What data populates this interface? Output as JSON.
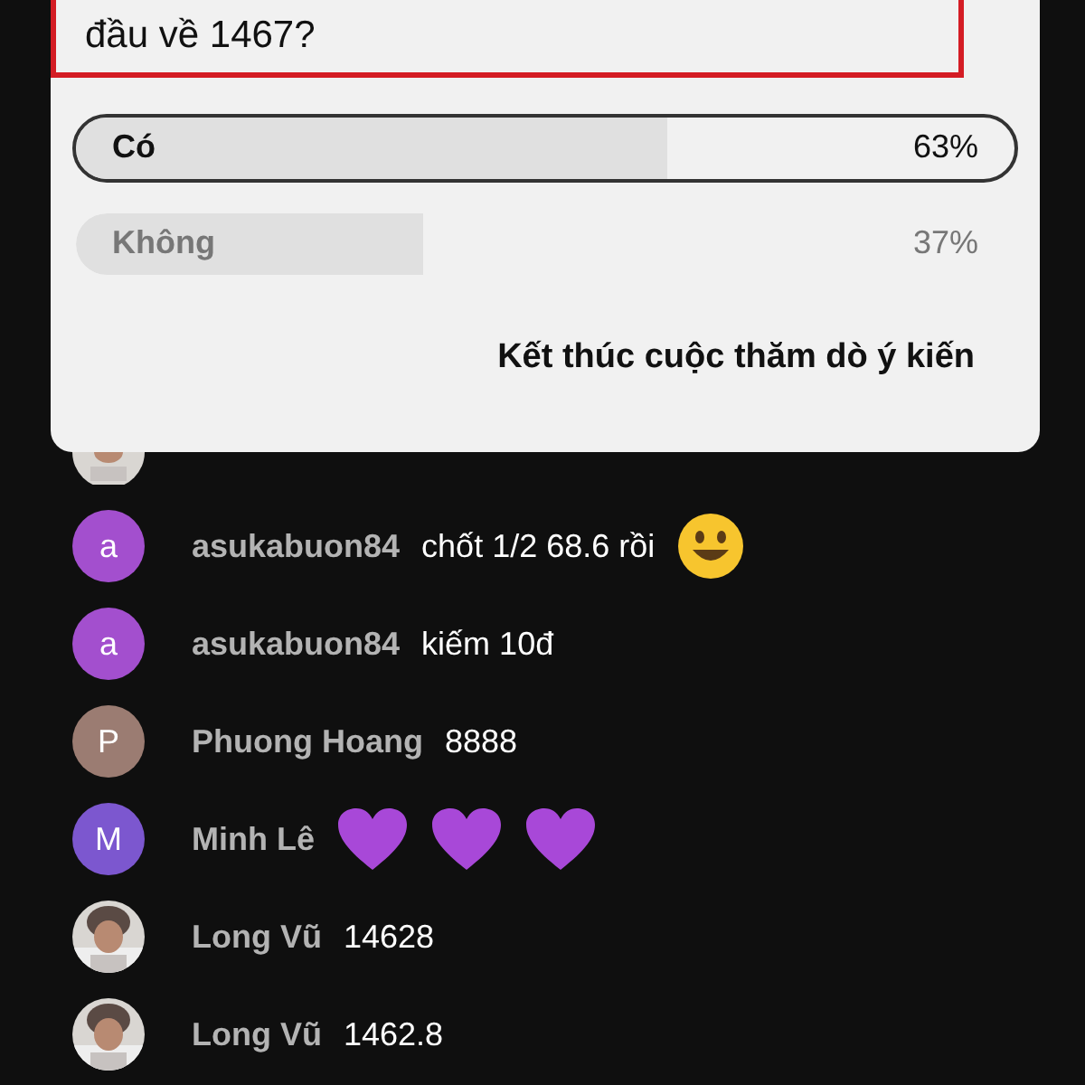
{
  "poll": {
    "question": "đầu về 1467?",
    "options": [
      {
        "label": "Có",
        "percent": "63%",
        "level": 0.63,
        "selected": true
      },
      {
        "label": "Không",
        "percent": "37%",
        "level": 0.37,
        "selected": false
      }
    ],
    "end_button": "Kết thúc cuộc thăm dò ý kiến"
  },
  "chat": [
    {
      "kind": "hidden"
    },
    {
      "kind": "message",
      "author": "asukabuon84",
      "text": "chốt 1/2 68.6 rồi",
      "avatar": {
        "kind": "letter",
        "letter": "a",
        "color": "#a34fce"
      },
      "emojis": [
        {
          "kind": "smile"
        }
      ]
    },
    {
      "kind": "message",
      "author": "asukabuon84",
      "text": "kiếm 10đ",
      "avatar": {
        "kind": "letter",
        "letter": "a",
        "color": "#a34fce"
      }
    },
    {
      "kind": "message",
      "author": "Phuong Hoang",
      "text": "8888",
      "avatar": {
        "kind": "letter",
        "letter": "P",
        "color": "#9b7c72"
      }
    },
    {
      "kind": "message",
      "author": "Minh Lê",
      "avatar": {
        "kind": "letter",
        "letter": "M",
        "color": "#7c57cf"
      },
      "emojis": [
        {
          "kind": "heart"
        },
        {
          "kind": "heart"
        },
        {
          "kind": "heart"
        }
      ]
    },
    {
      "kind": "message",
      "author": "Long Vũ",
      "text": "14628"
    },
    {
      "kind": "message",
      "author": "Long Vũ",
      "text": "1462.8"
    }
  ]
}
